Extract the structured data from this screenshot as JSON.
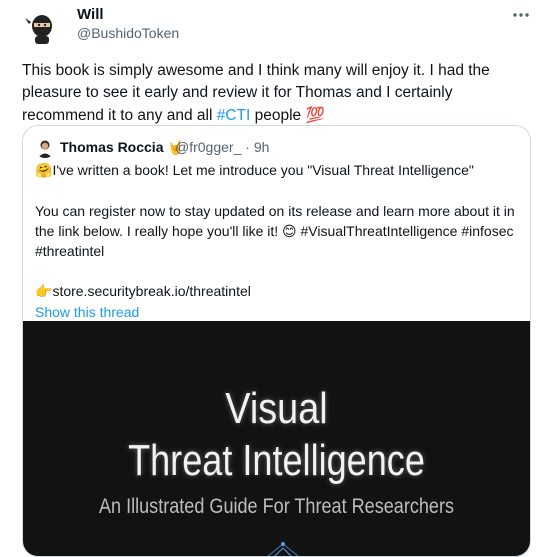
{
  "tweet": {
    "author_name": "Will",
    "author_handle": "@BushidoToken",
    "more_icon": "more-dots-icon",
    "text_part1": "This book is simply awesome and I think many will enjoy it. I had the pleasure to see it early and review it for Thomas and I certainly recommend it to any and all ",
    "hashtag": "#CTI",
    "text_part2": " people ",
    "emoji": "💯"
  },
  "quote": {
    "author_name": "Thomas Roccia",
    "author_emoji": "🤘",
    "author_handle": "@fr0gger_",
    "separator": "·",
    "time": "9h",
    "line1_emoji": "🤗",
    "line1": "I've written a book! Let me introduce you \"Visual Threat Intelligence\"",
    "paragraph2": "You can register now to stay updated on its release and learn more about it in the link below. I really hope you'll like it! 😊 #VisualThreatIntelligence #infosec #threatintel",
    "link_emoji": "👉",
    "link": "store.securitybreak.io/threatintel",
    "show_thread": "Show this thread"
  },
  "cover": {
    "title_line1": "Visual",
    "title_line2": "Threat Intelligence",
    "subtitle": "An Illustrated Guide For Threat Researchers"
  },
  "colors": {
    "accent": "#1d9bf0",
    "secondary_text": "#536471",
    "border": "#cfd9de",
    "cover_bg": "#121212"
  }
}
